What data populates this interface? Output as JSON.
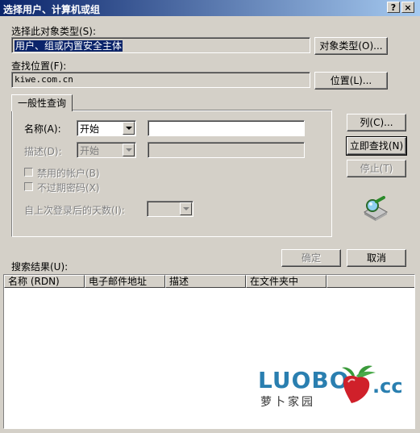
{
  "window": {
    "title": "选择用户、计算机或组",
    "help_button": "?",
    "close_button": "×"
  },
  "object_type": {
    "label": "选择此对象类型(S):",
    "value": "用户、组或内置安全主体",
    "button": "对象类型(O)..."
  },
  "location": {
    "label": "查找位置(F):",
    "value": "kiwe.com.cn",
    "button": "位置(L)..."
  },
  "query": {
    "tab": "一般性查询",
    "name_label": "名称(A):",
    "name_mode": "开始",
    "name_value": "",
    "desc_label": "描述(D):",
    "desc_mode": "开始",
    "desc_value": "",
    "disabled_accounts": "禁用的帐户(B)",
    "non_expiring_pw": "不过期密码(X)",
    "days_label": "自上次登录后的天数(I):",
    "days_value": ""
  },
  "side_buttons": {
    "columns": "列(C)...",
    "find_now": "立即查找(N)",
    "stop": "停止(T)"
  },
  "dialog_buttons": {
    "ok": "确定",
    "cancel": "取消"
  },
  "results": {
    "label": "搜索结果(U):",
    "columns": [
      "名称 (RDN)",
      "电子邮件地址",
      "描述",
      "在文件夹中"
    ]
  },
  "watermark": {
    "brand": "LUOBO",
    "domain": ".cc",
    "tagline": "萝卜家园"
  }
}
